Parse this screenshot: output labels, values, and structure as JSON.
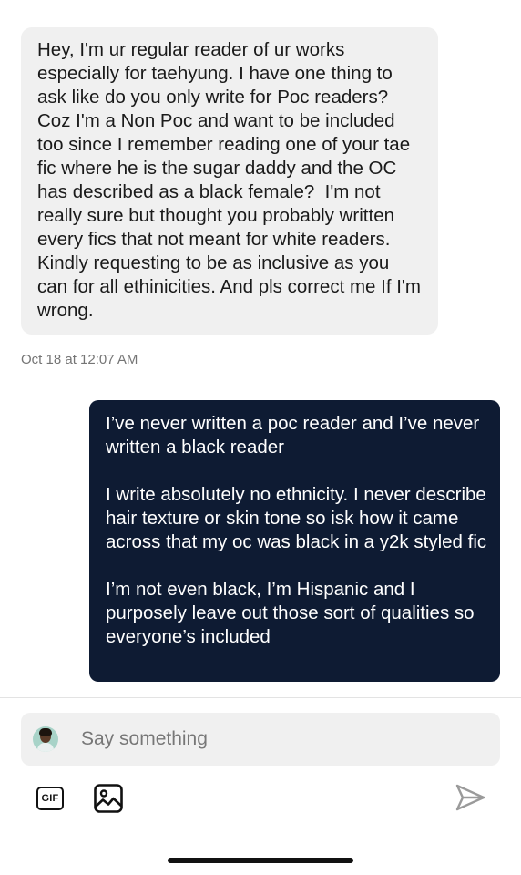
{
  "thread": {
    "incoming_message": "Hey, I'm ur regular reader of ur works especially for taehyung. I have one thing to ask like do you only write for Poc readers? Coz I'm a Non Poc and want to be included too since I remember reading one of your tae fic where he is the sugar daddy and the OC has described as a black female?  I'm not really sure but thought you probably written every fics that not meant for white readers. Kindly requesting to be as inclusive as you can for all ethinicities. And pls correct me If I'm wrong.",
    "timestamp": "Oct 18 at 12:07 AM",
    "outgoing_paragraphs": [
      "I’ve never written a poc reader and I’ve never written a black reader",
      "I write absolutely no ethnicity. I never describe hair texture or skin tone so isk how it came across that my oc was black in a y2k styled fic",
      "I’m not even black, I’m Hispanic and I purposely leave out those sort of qualities so everyone’s included"
    ]
  },
  "composer": {
    "placeholder": "Say something",
    "gif_label": "GIF",
    "icons": [
      "avatar",
      "gif-icon",
      "image-icon",
      "send-icon"
    ]
  },
  "colors": {
    "incoming_bubble": "#f0f0f0",
    "outgoing_bubble": "#0e1b33",
    "timestamp": "#757575"
  }
}
